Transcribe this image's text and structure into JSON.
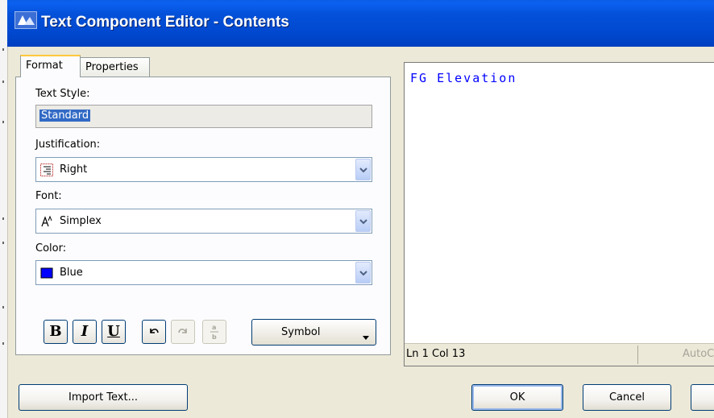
{
  "window": {
    "title": "Text Component Editor - Contents"
  },
  "tabs": [
    {
      "label": "Format",
      "active": true
    },
    {
      "label": "Properties",
      "active": false
    }
  ],
  "format": {
    "text_style": {
      "label": "Text Style:",
      "value": "Standard"
    },
    "justification": {
      "label": "Justification:",
      "value": "Right",
      "icon": "justify-right-icon"
    },
    "font": {
      "label": "Font:",
      "value": "Simplex",
      "icon": "font-icon"
    },
    "color": {
      "label": "Color:",
      "value": "Blue",
      "swatch": "#0000ff"
    },
    "toolbar": {
      "bold": "B",
      "italic": "I",
      "underline": "U",
      "undo_icon": "undo-icon",
      "redo_icon": "redo-icon",
      "stack_icon": "stack-fraction-icon",
      "symbol_label": "Symbol"
    }
  },
  "editor": {
    "content": "FG Elevation",
    "text_color": "#0000ff",
    "status_position": "Ln 1 Col 13",
    "status_autocaps": "AutoC"
  },
  "buttons": {
    "import": "Import Text...",
    "ok": "OK",
    "cancel": "Cancel"
  },
  "colors": {
    "titlebar": "#0451d9",
    "dialog_bg": "#ece9d8",
    "tab_highlight": "#ffc83c"
  }
}
